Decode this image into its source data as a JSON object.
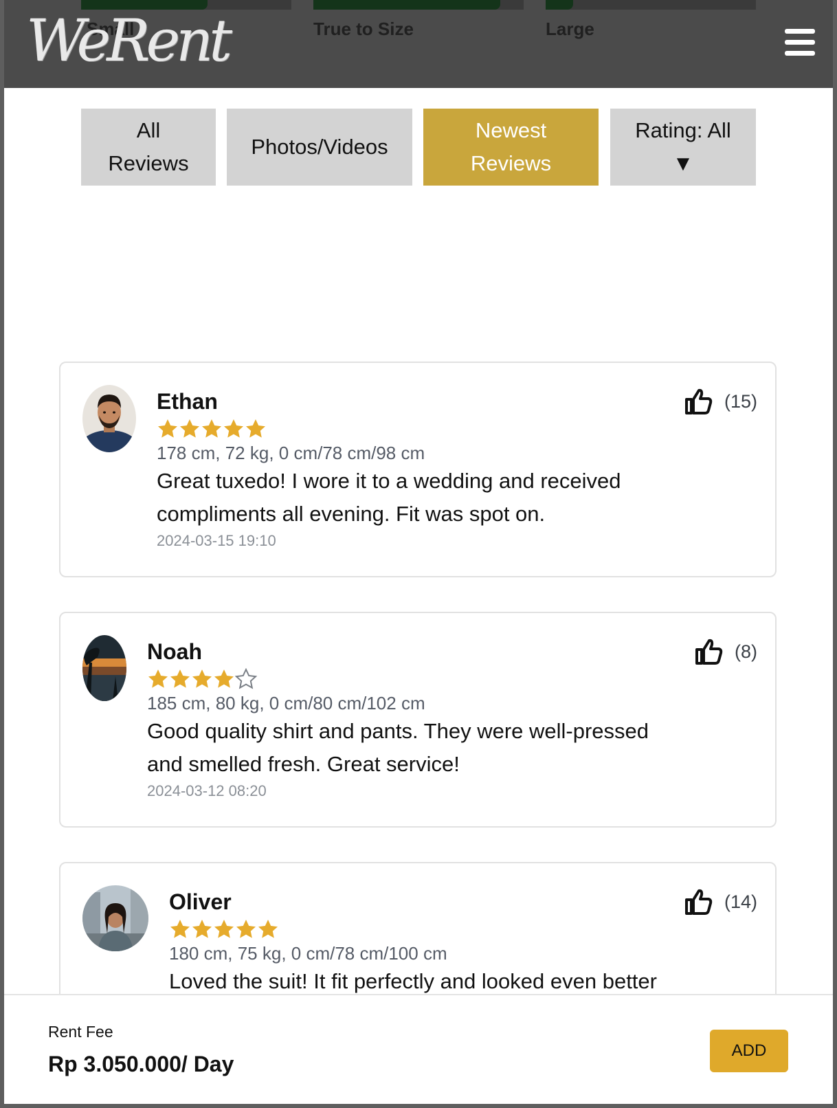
{
  "brand": {
    "logo_text": "WeRent"
  },
  "fit_scale": {
    "small_label": "Small",
    "true_label": "True to Size",
    "large_label": "Large",
    "small_fill": 0.6,
    "true_fill": 0.89,
    "large_fill": 0.13
  },
  "filters": {
    "all_line1": "All",
    "all_line2": "Reviews",
    "photos": "Photos/Videos",
    "newest_line1": "Newest",
    "newest_line2": "Reviews",
    "rating_line1": "Rating: All",
    "rating_arrow": "▼",
    "active": "Newest Reviews"
  },
  "reviews": [
    {
      "name": "Ethan",
      "rating": 5,
      "measurements": "178 cm, 72 kg, 0 cm/78 cm/98 cm",
      "text": "Great tuxedo! I wore it to a wedding and received compliments all evening. Fit was spot on.",
      "date": "2024-03-15 19:10",
      "likes": "(15)"
    },
    {
      "name": "Noah",
      "rating": 4,
      "measurements": "185 cm, 80 kg, 0 cm/80 cm/102 cm",
      "text": "Good quality shirt and pants. They were well-pressed and smelled fresh. Great service!",
      "date": "2024-03-12 08:20",
      "likes": "(8)"
    },
    {
      "name": "Oliver",
      "rating": 5,
      "measurements": "180 cm, 75 kg, 0 cm/78 cm/100 cm",
      "text": "Loved the suit! It fit perfectly and looked even better",
      "likes": "(14)"
    }
  ],
  "footer": {
    "fee_label": "Rent Fee",
    "fee_value": "Rp 3.050.000/ Day",
    "add_label": "ADD"
  },
  "colors": {
    "header": "#4b4b4b",
    "accent_gold": "#c9a63c",
    "star": "#e6ab2c",
    "fit_fill": "#14341a"
  }
}
